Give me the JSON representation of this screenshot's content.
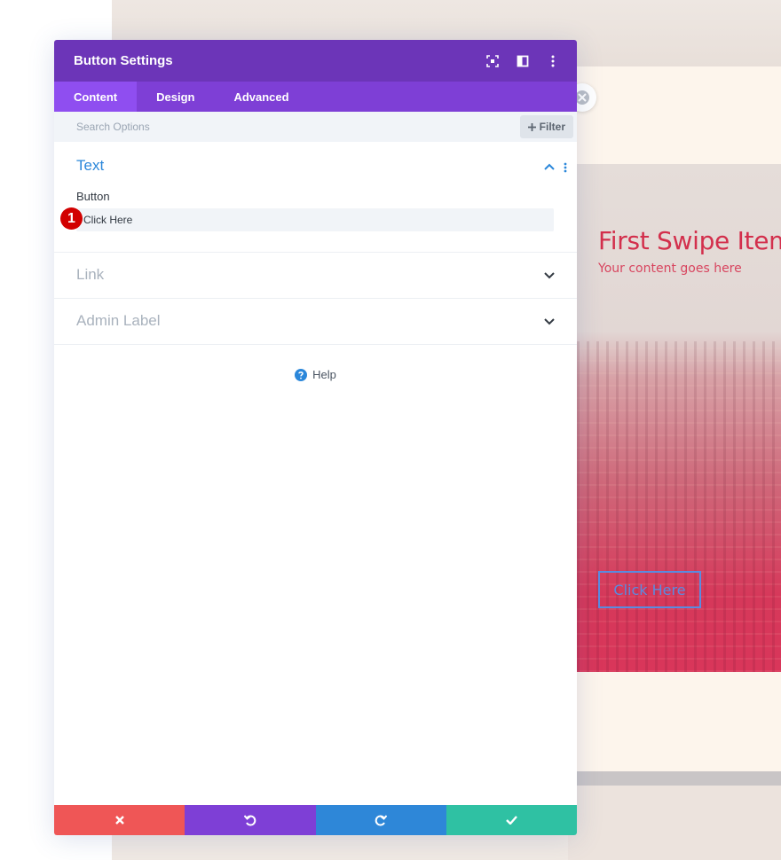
{
  "modal": {
    "title": "Button Settings",
    "tabs": [
      {
        "label": "Content",
        "active": true
      },
      {
        "label": "Design",
        "active": false
      },
      {
        "label": "Advanced",
        "active": false
      }
    ],
    "search": {
      "placeholder": "Search Options"
    },
    "filter": {
      "label": "Filter",
      "icon": "plus-icon"
    },
    "groups": {
      "text": {
        "title": "Text",
        "field_label": "Button",
        "field_value": "Click Here"
      },
      "link": {
        "title": "Link"
      },
      "admin_label": {
        "title": "Admin Label"
      }
    },
    "step_badge": "1",
    "help": {
      "label": "Help"
    },
    "footer": {
      "close_icon": "x-icon",
      "undo_icon": "undo-icon",
      "redo_icon": "redo-icon",
      "save_icon": "check-icon"
    }
  },
  "preview": {
    "slide_title": "First Swipe Item",
    "slide_subtitle": "Your content goes here",
    "slide_button": "Click Here"
  },
  "colors": {
    "header": "#6c35b8",
    "tabs": "#7e3fd6",
    "active_tab": "#8f4ef0",
    "accent_blue": "#2b87da",
    "close": "#ef5656",
    "save": "#2fc1a3",
    "slide_title": "#d32f4c"
  }
}
